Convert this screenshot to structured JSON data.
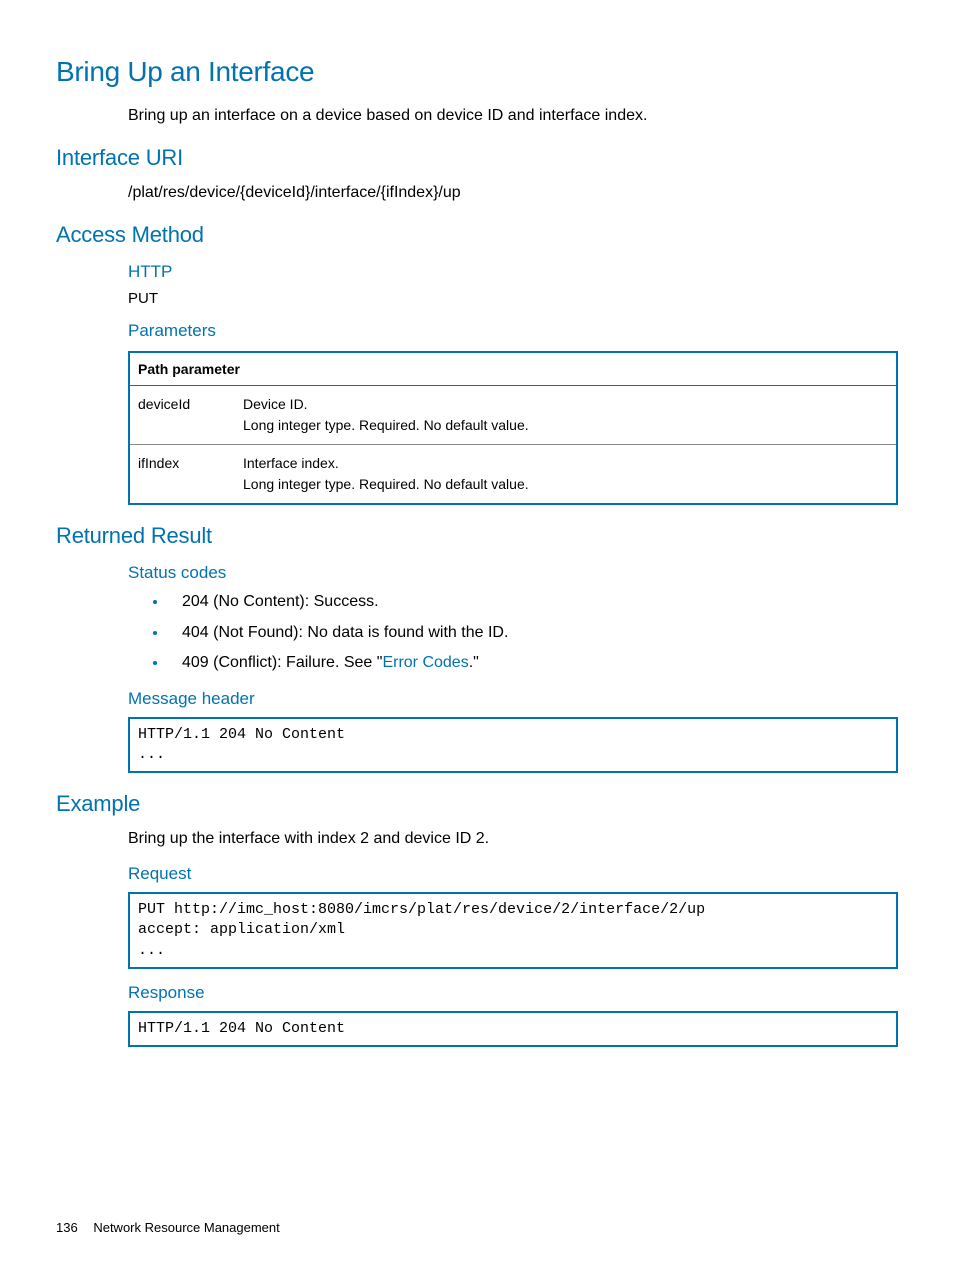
{
  "title": "Bring Up an Interface",
  "intro": "Bring up an interface on a device based on device ID and interface index.",
  "sections": {
    "interface_uri": {
      "heading": "Interface URI",
      "uri": "/plat/res/device/{deviceId}/interface/{ifIndex}/up"
    },
    "access_method": {
      "heading": "Access Method",
      "http_heading": "HTTP",
      "http_method": "PUT",
      "parameters_heading": "Parameters",
      "table": {
        "header": "Path parameter",
        "rows": [
          {
            "name": "deviceId",
            "line1": "Device ID.",
            "line2": "Long integer type. Required. No default value."
          },
          {
            "name": "ifIndex",
            "line1": "Interface index.",
            "line2": "Long integer type. Required. No default value."
          }
        ]
      }
    },
    "returned_result": {
      "heading": "Returned Result",
      "status_codes_heading": "Status codes",
      "status_codes": [
        "204 (No Content): Success.",
        "404 (Not Found): No data is found with the ID."
      ],
      "status_conflict_prefix": "409 (Conflict): Failure. See \"",
      "status_conflict_link": "Error Codes",
      "status_conflict_suffix": ".\"",
      "message_header_heading": "Message header",
      "message_header_code": "HTTP/1.1 204 No Content\n..."
    },
    "example": {
      "heading": "Example",
      "intro": "Bring up the interface with index 2 and device ID 2.",
      "request_heading": "Request",
      "request_code": "PUT http://imc_host:8080/imcrs/plat/res/device/2/interface/2/up\naccept: application/xml\n...",
      "response_heading": "Response",
      "response_code": "HTTP/1.1 204 No Content"
    }
  },
  "footer": {
    "page": "136",
    "section": "Network Resource Management"
  }
}
